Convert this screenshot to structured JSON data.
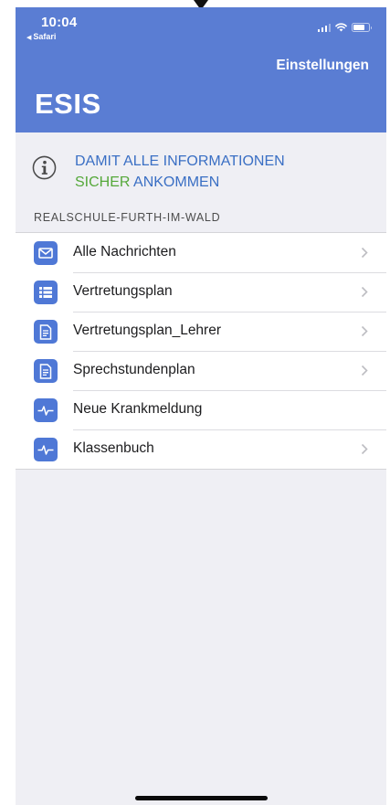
{
  "status_bar": {
    "time": "10:04",
    "back_app": "Safari"
  },
  "header": {
    "settings_label": "Einstellungen",
    "title": "ESIS"
  },
  "info_banner": {
    "line1": "DAMIT ALLE INFORMATIONEN",
    "line2_highlight": "SICHER",
    "line2_rest": "ANKOMMEN",
    "icon": "info-icon"
  },
  "section": {
    "title": "REALSCHULE-FURTH-IM-WALD"
  },
  "list": {
    "items": [
      {
        "label": "Alle Nachrichten",
        "icon": "mail-icon",
        "chevron": true
      },
      {
        "label": "Vertretungsplan",
        "icon": "list-icon",
        "chevron": true
      },
      {
        "label": "Vertretungsplan_Lehrer",
        "icon": "document-icon",
        "chevron": true
      },
      {
        "label": "Sprechstundenplan",
        "icon": "document-icon",
        "chevron": true
      },
      {
        "label": "Neue Krankmeldung",
        "icon": "pulse-icon",
        "chevron": false
      },
      {
        "label": "Klassenbuch",
        "icon": "pulse-icon",
        "chevron": true
      }
    ]
  },
  "colors": {
    "header_bg": "#5a7dd3",
    "icon_bg": "#4f78d6",
    "info_blue": "#3a6fc4",
    "info_green": "#55a83a",
    "page_bg": "#efeff4"
  }
}
